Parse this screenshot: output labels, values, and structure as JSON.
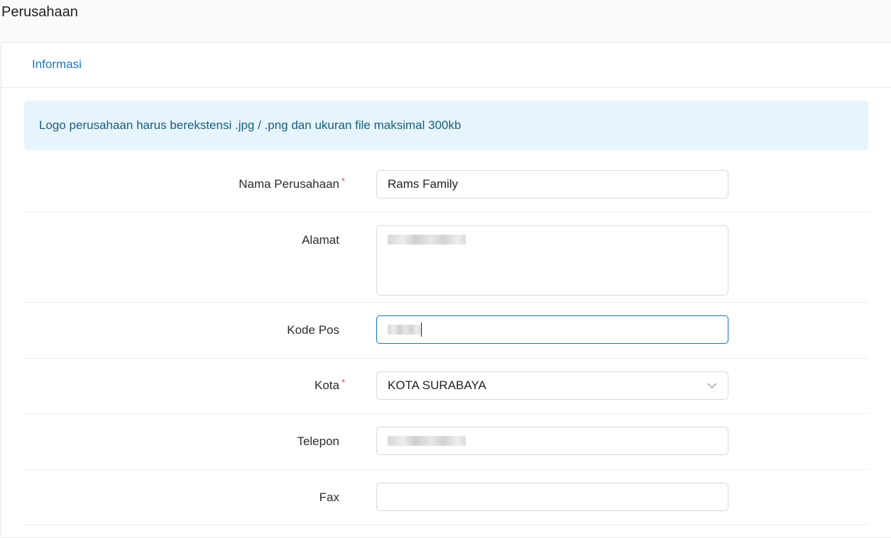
{
  "page": {
    "title": "Perusahaan"
  },
  "tabs": [
    {
      "label": "Informasi",
      "active": true
    }
  ],
  "alert": {
    "text": "Logo perusahaan harus berekstensi .jpg / .png dan ukuran file maksimal 300kb"
  },
  "form": {
    "nama_perusahaan": {
      "label": "Nama Perusahaan",
      "required": true,
      "value": "Rams Family"
    },
    "alamat": {
      "label": "Alamat",
      "required": false,
      "value_redacted": true
    },
    "kode_pos": {
      "label": "Kode Pos",
      "required": false,
      "value_redacted": true,
      "focused": true
    },
    "kota": {
      "label": "Kota",
      "required": true,
      "value": "KOTA SURABAYA"
    },
    "telepon": {
      "label": "Telepon",
      "required": false,
      "value_redacted": true
    },
    "fax": {
      "label": "Fax",
      "required": false,
      "value": ""
    }
  },
  "required_marker": "*",
  "colors": {
    "accent": "#1677c8",
    "alert_bg": "#e6f4fd",
    "alert_text": "#1b5e7a",
    "required": "#e5484d"
  }
}
